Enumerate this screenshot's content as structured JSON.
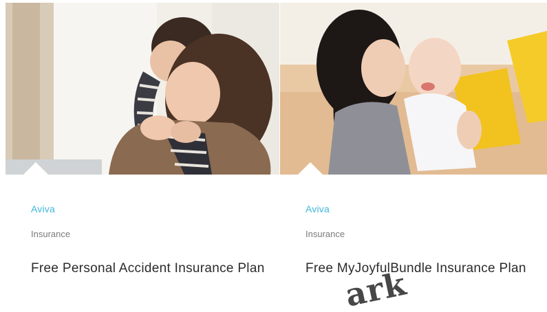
{
  "cards": [
    {
      "image_alt": "Woman carrying a child on her back",
      "brand": "Aviva",
      "category": "Insurance",
      "title": "Free Personal Accident Insurance Plan"
    },
    {
      "image_alt": "Mother kissing a smiling baby on a sofa",
      "brand": "Aviva",
      "category": "Insurance",
      "title": "Free MyJoyfulBundle Insurance Plan"
    }
  ],
  "watermark": "ark",
  "colors": {
    "brand": "#3fb6d8",
    "title": "#2b2b2b",
    "category": "#7a7a7a"
  }
}
